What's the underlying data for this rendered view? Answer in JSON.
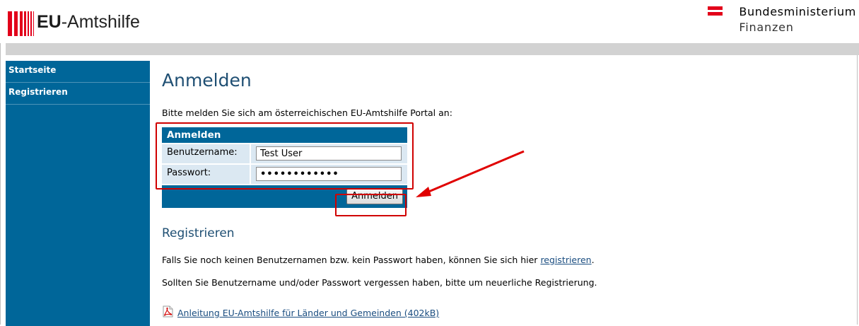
{
  "header": {
    "logo_bold": "EU",
    "logo_rest": "-Amtshilfe",
    "ministry_line1": "Bundesministerium",
    "ministry_line2": "Finanzen",
    "logo_bar_colors": [
      "#e2001a",
      "#e2001a",
      "#e2001a",
      "#e2001a",
      "#e2001a"
    ]
  },
  "sidebar": {
    "items": [
      {
        "label": "Startseite"
      },
      {
        "label": "Registrieren"
      }
    ]
  },
  "main": {
    "title": "Anmelden",
    "intro": "Bitte melden Sie sich am österreichischen EU-Amtshilfe Portal an:",
    "login": {
      "header": "Anmelden",
      "username_label": "Benutzername:",
      "username_value": "Test User",
      "password_label": "Passwort:",
      "password_value": "••••••••••••",
      "submit_label": "Anmelden"
    },
    "register": {
      "title": "Registrieren",
      "line1_before": "Falls Sie noch keinen Benutzernamen bzw. kein Passwort haben, können Sie sich hier ",
      "line1_link": "registrieren",
      "line1_after": ".",
      "line2": "Sollten Sie Benutzername und/oder Passwort vergessen haben, bitte um neuerliche Registrierung.",
      "pdf_link": "Anleitung EU-Amtshilfe für Länder und Gemeinden (402kB)"
    }
  },
  "colors": {
    "accent_blue": "#006699",
    "annotation_red": "#d00000",
    "brand_red": "#e2001a"
  },
  "icons": {
    "pdf": "pdf-icon"
  }
}
